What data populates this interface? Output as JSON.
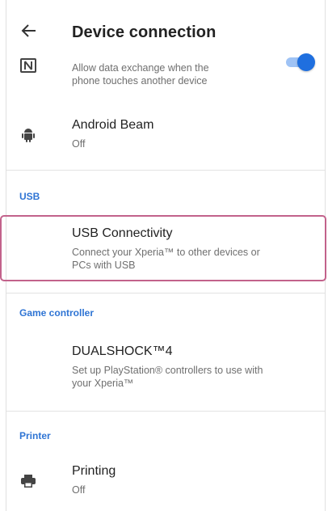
{
  "appbar": {
    "title": "Device connection",
    "back_icon": "back-arrow-icon"
  },
  "nfc": {
    "icon": "nfc-icon",
    "summary": "Allow data exchange when the phone touches another device",
    "summary_line1": "Allow data exchange when the",
    "summary_line2": "phone touches another device",
    "toggle_on": true
  },
  "android_beam": {
    "icon": "android-icon",
    "title": "Android Beam",
    "summary": "Off"
  },
  "usb_section": {
    "header": "USB"
  },
  "usb_connectivity": {
    "title": "USB Connectivity",
    "summary_line1": "Connect your Xperia™ to other devices or",
    "summary_line2": "PCs with USB"
  },
  "game_section": {
    "header": "Game controller"
  },
  "dualshock": {
    "title": "DUALSHOCK™4",
    "summary_line1": "Set up PlayStation® controllers to use with",
    "summary_line2": "your Xperia™"
  },
  "printer_section": {
    "header": "Printer"
  },
  "printing": {
    "icon": "printer-icon",
    "title": "Printing",
    "summary": "Off"
  },
  "colors": {
    "accent": "#2e74d4",
    "toggle_thumb": "#1f6fdf",
    "highlight": "#c2628b"
  }
}
